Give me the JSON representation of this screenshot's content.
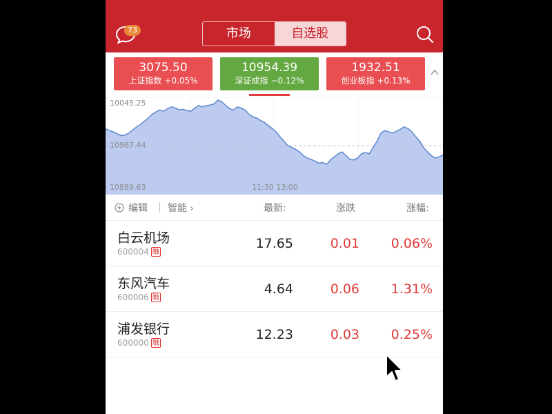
{
  "header": {
    "badge_count": "73",
    "tabs": [
      "市场",
      "自选股"
    ],
    "active_tab": "自选股"
  },
  "indices": [
    {
      "value": "3075.50",
      "name": "上证指数",
      "change": "+0.05%",
      "color": "#e94f52"
    },
    {
      "value": "10954.39",
      "name": "深证成指",
      "change": "−0.12%",
      "color": "#64a841"
    },
    {
      "value": "1932.51",
      "name": "创业板指",
      "change": "+0.13%",
      "color": "#e94f52"
    }
  ],
  "chart": {
    "y_high": "10045.25",
    "y_mid": "10967.44",
    "y_low": "10889.63",
    "time_labels": "11:30 13:00"
  },
  "chart_data": {
    "type": "area",
    "ylim": [
      10889.63,
      11045.25
    ],
    "reference": 10967.44,
    "values": [
      10995,
      10992,
      10990,
      10987,
      10984,
      10985,
      10988,
      10993,
      10998,
      11002,
      11007,
      11012,
      11018,
      11022,
      11025,
      11023,
      11027,
      11030,
      11028,
      11025,
      11026,
      11024,
      11023,
      11028,
      11032,
      11030,
      11032,
      11033,
      11035,
      11041,
      11038,
      11032,
      11027,
      11025,
      11030,
      11028,
      11025,
      11018,
      11014,
      11012,
      11008,
      11005,
      11000,
      10995,
      10990,
      10982,
      10975,
      10968,
      10965,
      10962,
      10958,
      10952,
      10948,
      10946,
      10943,
      10940,
      10941,
      10938,
      10945,
      10950,
      10955,
      10958,
      10952,
      10946,
      10945,
      10948,
      10955,
      10957,
      10955,
      10965,
      10975,
      10988,
      10992,
      10990,
      10988,
      10991,
      10994,
      10998,
      10995,
      10990,
      10982,
      10975,
      10965,
      10958,
      10952,
      10948,
      10950,
      10953
    ]
  },
  "list": {
    "edit_label": "编辑",
    "smart_label": "智能",
    "col_price": "最新:",
    "col_change": "涨跌",
    "col_pct": "涨幅:",
    "rows": [
      {
        "name": "白云机场",
        "code": "600004",
        "tag": "融",
        "price": "17.65",
        "change": "0.01",
        "pct": "0.06%"
      },
      {
        "name": "东风汽车",
        "code": "600006",
        "tag": "融",
        "price": "4.64",
        "change": "0.06",
        "pct": "1.31%"
      },
      {
        "name": "浦发银行",
        "code": "600000",
        "tag": "融",
        "price": "12.23",
        "change": "0.03",
        "pct": "0.25%"
      }
    ]
  },
  "colors": {
    "brand": "#c8252c",
    "up": "#e03a3a",
    "down": "#64a841",
    "chart_fill": "#bccbef",
    "chart_line": "#5b87cf"
  }
}
